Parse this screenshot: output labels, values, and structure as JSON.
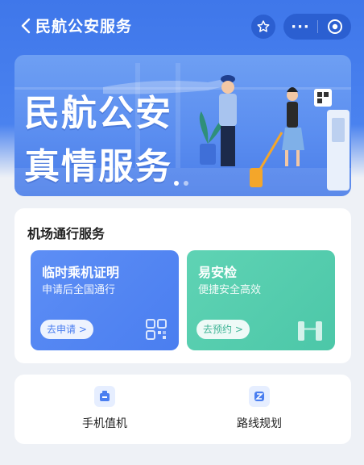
{
  "navbar": {
    "title": "民航公安服务",
    "back_icon": "chevron-left-icon",
    "star_icon": "star-icon",
    "more_label": "···",
    "close_icon": "target-close-icon"
  },
  "banner": {
    "line1": "民航公安",
    "line2": "真情服务",
    "page_count": 2,
    "active_index": 0
  },
  "service": {
    "title": "机场通行服务",
    "tiles": [
      {
        "title": "临时乘机证明",
        "subtitle": "申请后全国通行",
        "button": "去申请 >",
        "icon": "qr-code-icon",
        "color": "#5b8cf3"
      },
      {
        "title": "易安检",
        "subtitle": "便捷安全高效",
        "button": "去预约 >",
        "icon": "security-gate-icon",
        "color": "#56cdb0"
      }
    ]
  },
  "quick": {
    "items": [
      {
        "label": "手机值机",
        "icon": "checkin-icon"
      },
      {
        "label": "路线规划",
        "icon": "route-icon"
      }
    ]
  },
  "colors": {
    "primary": "#4a7ef0",
    "green": "#4cc7a8",
    "background": "#eef1f6"
  }
}
